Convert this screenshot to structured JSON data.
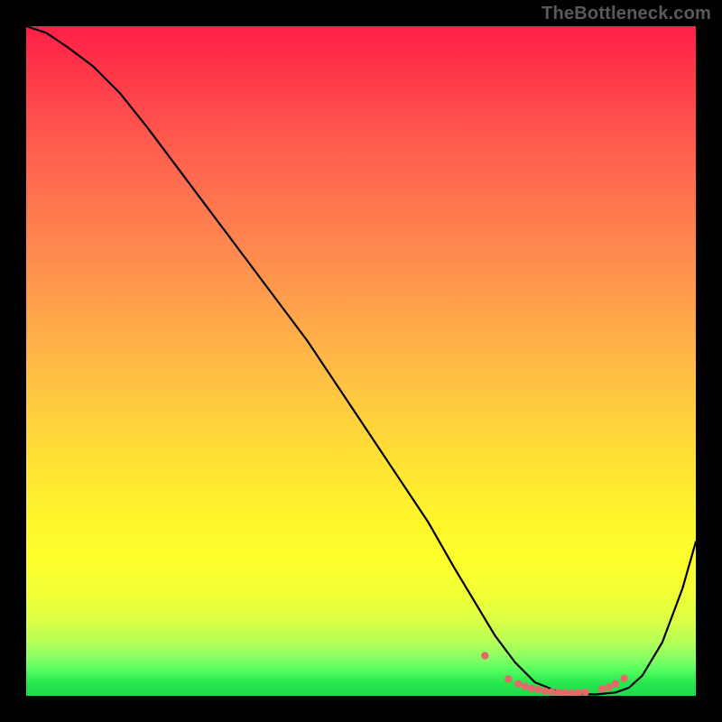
{
  "watermark": "TheBottleneck.com",
  "chart_data": {
    "type": "line",
    "title": "",
    "xlabel": "",
    "ylabel": "",
    "xlim": [
      0,
      100
    ],
    "ylim": [
      0,
      100
    ],
    "grid": false,
    "series": [
      {
        "name": "bottleneck-curve",
        "x": [
          0,
          3,
          6,
          10,
          14,
          18,
          24,
          30,
          36,
          42,
          48,
          54,
          60,
          64,
          67,
          70,
          73,
          76,
          79,
          82,
          85,
          88,
          90,
          92,
          95,
          98,
          100
        ],
        "y": [
          100,
          99,
          97,
          94,
          90,
          85,
          77,
          69,
          61,
          53,
          44,
          35,
          26,
          19,
          14,
          9,
          5,
          2,
          0.8,
          0.3,
          0.2,
          0.5,
          1.2,
          3.0,
          8.0,
          16.0,
          23.0
        ]
      }
    ],
    "markers": {
      "name": "trough-dots",
      "color": "#e46a6a",
      "x": [
        68.5,
        72.0,
        73.5,
        74.5,
        75.5,
        76.5,
        77.5,
        78.5,
        79.5,
        80.5,
        81.5,
        82.5,
        83.5,
        86.0,
        87.0,
        88.0,
        89.3
      ],
      "y": [
        6.0,
        2.5,
        1.8,
        1.4,
        1.1,
        0.9,
        0.7,
        0.6,
        0.5,
        0.45,
        0.4,
        0.45,
        0.55,
        1.0,
        1.3,
        1.8,
        2.6
      ]
    },
    "annotations": []
  }
}
